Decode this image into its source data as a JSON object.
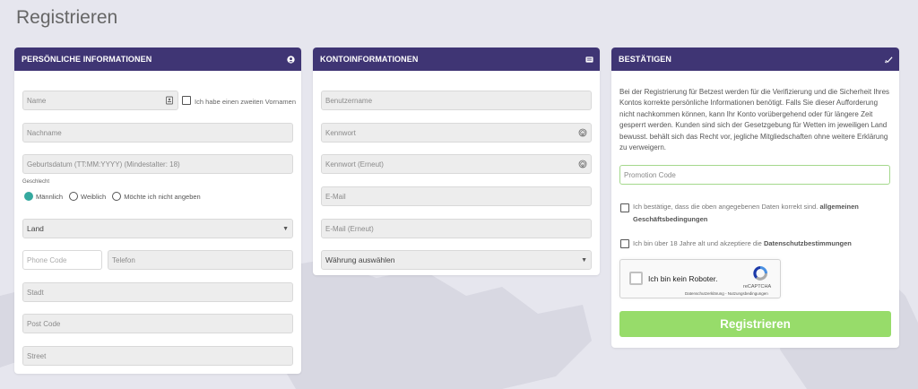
{
  "page": {
    "title": "Registrieren"
  },
  "personal": {
    "header": "Persönliche Informationen",
    "icon": "user-circle-icon",
    "name_placeholder": "Name",
    "second_name_label": "Ich habe einen zweiten Vornamen",
    "surname_placeholder": "Nachname",
    "birthdate_placeholder": "Geburtsdatum (TT:MM:YYYY) (Mindestalter: 18)",
    "gender_label": "Geschlecht",
    "gender_options": [
      "Männlich",
      "Weiblich",
      "Möchte ich nicht angeben"
    ],
    "gender_selected": "Männlich",
    "country_value": "Land",
    "phone_code_placeholder": "Phone Code",
    "phone_placeholder": "Telefon",
    "city_placeholder": "Stadt",
    "postcode_placeholder": "Post Code",
    "street_placeholder": "Street"
  },
  "account": {
    "header": "Kontoinformationen",
    "icon": "id-card-icon",
    "username_placeholder": "Benutzername",
    "password_placeholder": "Kennwort",
    "password_repeat_placeholder": "Kennwort (Erneut)",
    "email_placeholder": "E-Mail",
    "email_repeat_placeholder": "E-Mail (Erneut)",
    "currency_value": "Währung auswählen"
  },
  "confirm": {
    "header": "Bestätigen",
    "icon": "checkmark-icon",
    "info_text": "Bei der Registrierung für Betzest werden für die Verifizierung und die Sicherheit Ihres Kontos korrekte persönliche Informationen benötigt. Falls Sie dieser Aufforderung nicht nachkommen können, kann Ihr Konto vorübergehend oder für längere Zeit gesperrt werden. Kunden sind sich der Gesetzgebung für Wetten im jeweiligen Land bewusst. behält sich das Recht vor, jegliche Mitgliedschaften ohne weitere Erklärung zu verweigern.",
    "promo_placeholder": "Promotion Code",
    "terms_prefix": "Ich bestätige, dass die oben angegebenen Daten korrekt sind.",
    "terms_link": "allgemeinen Geschäftsbedingungen",
    "privacy_prefix": "Ich bin über 18 Jahre alt und akzeptiere die",
    "privacy_link": "Datenschutzbestimmungen",
    "recaptcha_label": "Ich bin kein Roboter.",
    "recaptcha_brand": "reCAPTCHA",
    "recaptcha_links": "Datenschutzerklärung - Nutzungsbedingungen",
    "submit_label": "Registrieren"
  },
  "colors": {
    "header_bg": "#3f3574",
    "accent_teal": "#35a99f",
    "submit_green": "#97dc6a"
  }
}
